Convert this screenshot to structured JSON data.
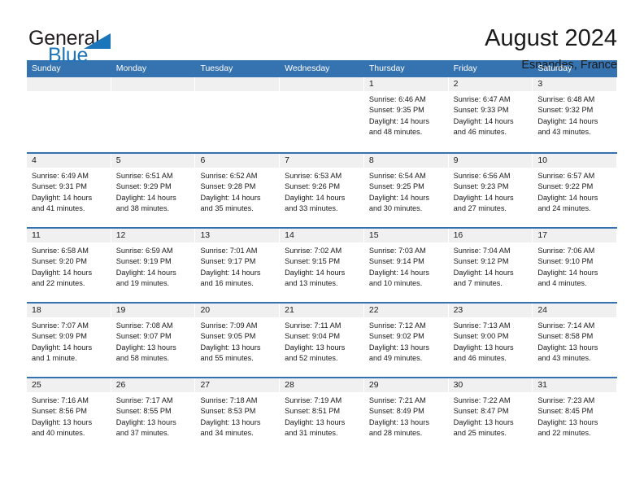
{
  "logo": {
    "word_one": "General",
    "word_two": "Blue",
    "triangle_color": "#1b75bb",
    "text_color": "#231f20"
  },
  "header": {
    "title": "August 2024",
    "subtitle": "Esnandes, France"
  },
  "theme": {
    "header_blue": "#3572b0",
    "day_band_gray": "#f0f0f0",
    "text": "#1a1a1a"
  },
  "weekdays": [
    "Sunday",
    "Monday",
    "Tuesday",
    "Wednesday",
    "Thursday",
    "Friday",
    "Saturday"
  ],
  "weeks": [
    [
      {
        "day": "",
        "sunrise": "",
        "sunset": "",
        "daylight": "",
        "empty": true
      },
      {
        "day": "",
        "sunrise": "",
        "sunset": "",
        "daylight": "",
        "empty": true
      },
      {
        "day": "",
        "sunrise": "",
        "sunset": "",
        "daylight": "",
        "empty": true
      },
      {
        "day": "",
        "sunrise": "",
        "sunset": "",
        "daylight": "",
        "empty": true
      },
      {
        "day": "1",
        "sunrise": "Sunrise: 6:46 AM",
        "sunset": "Sunset: 9:35 PM",
        "daylight": "Daylight: 14 hours and 48 minutes."
      },
      {
        "day": "2",
        "sunrise": "Sunrise: 6:47 AM",
        "sunset": "Sunset: 9:33 PM",
        "daylight": "Daylight: 14 hours and 46 minutes."
      },
      {
        "day": "3",
        "sunrise": "Sunrise: 6:48 AM",
        "sunset": "Sunset: 9:32 PM",
        "daylight": "Daylight: 14 hours and 43 minutes."
      }
    ],
    [
      {
        "day": "4",
        "sunrise": "Sunrise: 6:49 AM",
        "sunset": "Sunset: 9:31 PM",
        "daylight": "Daylight: 14 hours and 41 minutes."
      },
      {
        "day": "5",
        "sunrise": "Sunrise: 6:51 AM",
        "sunset": "Sunset: 9:29 PM",
        "daylight": "Daylight: 14 hours and 38 minutes."
      },
      {
        "day": "6",
        "sunrise": "Sunrise: 6:52 AM",
        "sunset": "Sunset: 9:28 PM",
        "daylight": "Daylight: 14 hours and 35 minutes."
      },
      {
        "day": "7",
        "sunrise": "Sunrise: 6:53 AM",
        "sunset": "Sunset: 9:26 PM",
        "daylight": "Daylight: 14 hours and 33 minutes."
      },
      {
        "day": "8",
        "sunrise": "Sunrise: 6:54 AM",
        "sunset": "Sunset: 9:25 PM",
        "daylight": "Daylight: 14 hours and 30 minutes."
      },
      {
        "day": "9",
        "sunrise": "Sunrise: 6:56 AM",
        "sunset": "Sunset: 9:23 PM",
        "daylight": "Daylight: 14 hours and 27 minutes."
      },
      {
        "day": "10",
        "sunrise": "Sunrise: 6:57 AM",
        "sunset": "Sunset: 9:22 PM",
        "daylight": "Daylight: 14 hours and 24 minutes."
      }
    ],
    [
      {
        "day": "11",
        "sunrise": "Sunrise: 6:58 AM",
        "sunset": "Sunset: 9:20 PM",
        "daylight": "Daylight: 14 hours and 22 minutes."
      },
      {
        "day": "12",
        "sunrise": "Sunrise: 6:59 AM",
        "sunset": "Sunset: 9:19 PM",
        "daylight": "Daylight: 14 hours and 19 minutes."
      },
      {
        "day": "13",
        "sunrise": "Sunrise: 7:01 AM",
        "sunset": "Sunset: 9:17 PM",
        "daylight": "Daylight: 14 hours and 16 minutes."
      },
      {
        "day": "14",
        "sunrise": "Sunrise: 7:02 AM",
        "sunset": "Sunset: 9:15 PM",
        "daylight": "Daylight: 14 hours and 13 minutes."
      },
      {
        "day": "15",
        "sunrise": "Sunrise: 7:03 AM",
        "sunset": "Sunset: 9:14 PM",
        "daylight": "Daylight: 14 hours and 10 minutes."
      },
      {
        "day": "16",
        "sunrise": "Sunrise: 7:04 AM",
        "sunset": "Sunset: 9:12 PM",
        "daylight": "Daylight: 14 hours and 7 minutes."
      },
      {
        "day": "17",
        "sunrise": "Sunrise: 7:06 AM",
        "sunset": "Sunset: 9:10 PM",
        "daylight": "Daylight: 14 hours and 4 minutes."
      }
    ],
    [
      {
        "day": "18",
        "sunrise": "Sunrise: 7:07 AM",
        "sunset": "Sunset: 9:09 PM",
        "daylight": "Daylight: 14 hours and 1 minute."
      },
      {
        "day": "19",
        "sunrise": "Sunrise: 7:08 AM",
        "sunset": "Sunset: 9:07 PM",
        "daylight": "Daylight: 13 hours and 58 minutes."
      },
      {
        "day": "20",
        "sunrise": "Sunrise: 7:09 AM",
        "sunset": "Sunset: 9:05 PM",
        "daylight": "Daylight: 13 hours and 55 minutes."
      },
      {
        "day": "21",
        "sunrise": "Sunrise: 7:11 AM",
        "sunset": "Sunset: 9:04 PM",
        "daylight": "Daylight: 13 hours and 52 minutes."
      },
      {
        "day": "22",
        "sunrise": "Sunrise: 7:12 AM",
        "sunset": "Sunset: 9:02 PM",
        "daylight": "Daylight: 13 hours and 49 minutes."
      },
      {
        "day": "23",
        "sunrise": "Sunrise: 7:13 AM",
        "sunset": "Sunset: 9:00 PM",
        "daylight": "Daylight: 13 hours and 46 minutes."
      },
      {
        "day": "24",
        "sunrise": "Sunrise: 7:14 AM",
        "sunset": "Sunset: 8:58 PM",
        "daylight": "Daylight: 13 hours and 43 minutes."
      }
    ],
    [
      {
        "day": "25",
        "sunrise": "Sunrise: 7:16 AM",
        "sunset": "Sunset: 8:56 PM",
        "daylight": "Daylight: 13 hours and 40 minutes."
      },
      {
        "day": "26",
        "sunrise": "Sunrise: 7:17 AM",
        "sunset": "Sunset: 8:55 PM",
        "daylight": "Daylight: 13 hours and 37 minutes."
      },
      {
        "day": "27",
        "sunrise": "Sunrise: 7:18 AM",
        "sunset": "Sunset: 8:53 PM",
        "daylight": "Daylight: 13 hours and 34 minutes."
      },
      {
        "day": "28",
        "sunrise": "Sunrise: 7:19 AM",
        "sunset": "Sunset: 8:51 PM",
        "daylight": "Daylight: 13 hours and 31 minutes."
      },
      {
        "day": "29",
        "sunrise": "Sunrise: 7:21 AM",
        "sunset": "Sunset: 8:49 PM",
        "daylight": "Daylight: 13 hours and 28 minutes."
      },
      {
        "day": "30",
        "sunrise": "Sunrise: 7:22 AM",
        "sunset": "Sunset: 8:47 PM",
        "daylight": "Daylight: 13 hours and 25 minutes."
      },
      {
        "day": "31",
        "sunrise": "Sunrise: 7:23 AM",
        "sunset": "Sunset: 8:45 PM",
        "daylight": "Daylight: 13 hours and 22 minutes."
      }
    ]
  ]
}
